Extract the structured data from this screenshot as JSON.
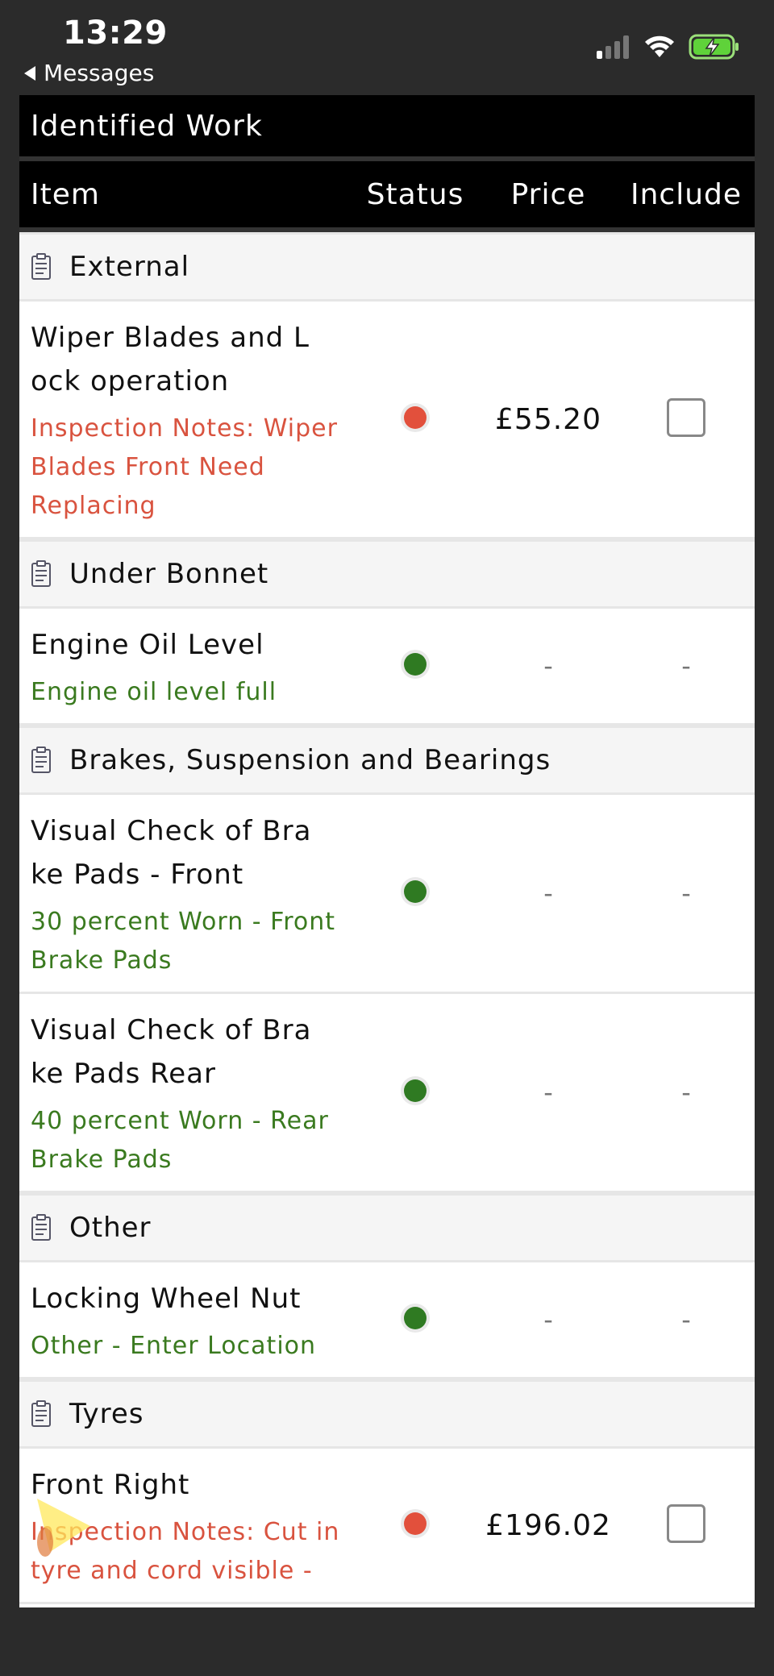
{
  "status_bar": {
    "time": "13:29",
    "back_label": "Messages",
    "icons": [
      "signal-icon",
      "wifi-icon",
      "battery-charging-icon"
    ]
  },
  "section": {
    "title": "Identified Work"
  },
  "columns": {
    "item": "Item",
    "status": "Status",
    "price": "Price",
    "include": "Include"
  },
  "categories": [
    {
      "label": "External",
      "items": [
        {
          "name_line1": "Wiper Blades and L",
          "name_line2": "ock operation",
          "note": "Inspection Notes: Wiper Blades Front Need Replacing",
          "status": "red",
          "price": "£55.20",
          "include": "checkbox"
        }
      ]
    },
    {
      "label": "Under Bonnet",
      "items": [
        {
          "name_line1": "Engine Oil Level",
          "name_line2": "",
          "note": "Engine oil level full",
          "status": "green",
          "price": "-",
          "include": "-"
        }
      ]
    },
    {
      "label": "Brakes, Suspension and Bearings",
      "items": [
        {
          "name_line1": "Visual Check of Bra",
          "name_line2": "ke Pads - Front",
          "note": "30 percent Worn - Front Brake Pads",
          "status": "green",
          "price": "-",
          "include": "-"
        },
        {
          "name_line1": "Visual Check of Bra",
          "name_line2": "ke Pads Rear",
          "note": "40 percent Worn - Rear Brake Pads",
          "status": "green",
          "price": "-",
          "include": "-"
        }
      ]
    },
    {
      "label": "Other",
      "items": [
        {
          "name_line1": "Locking Wheel Nut",
          "name_line2": "",
          "note": "Other - Enter Location",
          "status": "green",
          "price": "-",
          "include": "-"
        }
      ]
    },
    {
      "label": "Tyres",
      "items": [
        {
          "name_line1": "Front Right",
          "name_line2": "",
          "note": "Inspection Notes: Cut in tyre and cord visible -",
          "status": "red",
          "price": "£196.02",
          "include": "checkbox"
        }
      ]
    }
  ],
  "colors": {
    "status_red": "#e2503c",
    "status_green": "#2f7a22",
    "note_red": "#d9533f",
    "note_green": "#3a7a1f",
    "header_bg": "#000000"
  }
}
